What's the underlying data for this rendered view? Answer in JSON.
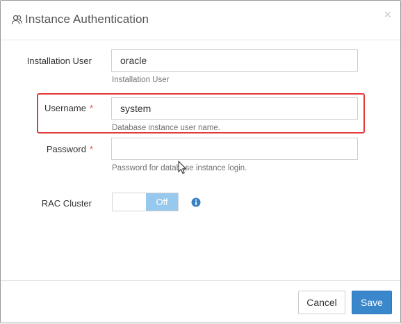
{
  "dialog": {
    "title": "Instance Authentication",
    "close_label": "×"
  },
  "fields": {
    "installation_user": {
      "label": "Installation User",
      "value": "oracle",
      "help": "Installation User"
    },
    "username": {
      "label": "Username",
      "required_mark": "*",
      "value": "system",
      "help": "Database instance user name."
    },
    "password": {
      "label": "Password",
      "required_mark": "*",
      "value": "",
      "help": "Password for database instance login."
    },
    "rac_cluster": {
      "label": "RAC Cluster",
      "toggle_state": "Off"
    }
  },
  "buttons": {
    "cancel": "Cancel",
    "save": "Save"
  },
  "colors": {
    "accent": "#3a87cc",
    "highlight": "#e23a3a",
    "required": "#d9534f",
    "toggle_off": "#97c8ee"
  },
  "icons": {
    "title": "user-group-icon",
    "close": "close-icon",
    "info": "info-circle-icon"
  }
}
